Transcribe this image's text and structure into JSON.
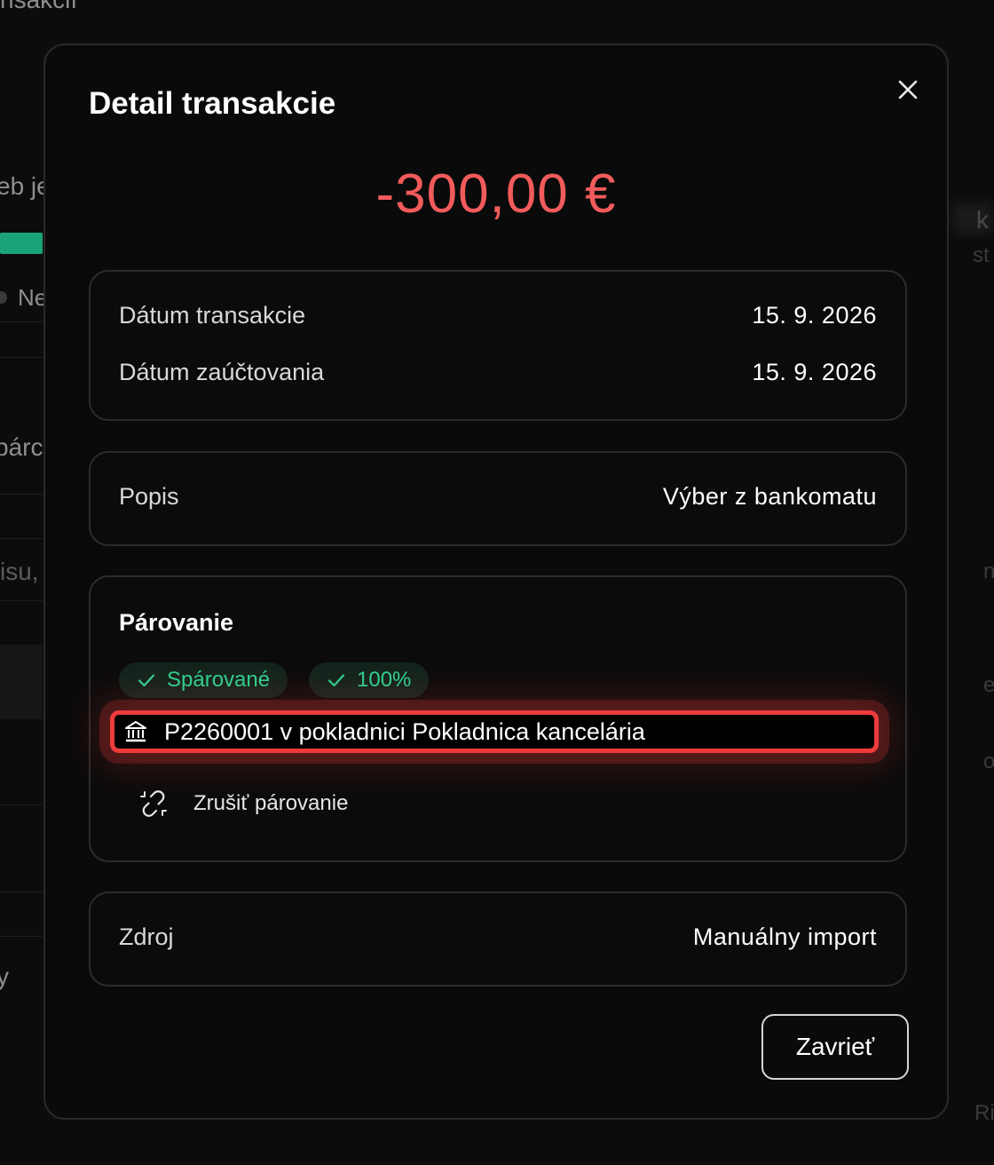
{
  "background": {
    "fragments": [
      "nsakcií",
      "eb je",
      "Ne",
      "párc",
      "isu,",
      "y",
      "k",
      "st",
      "n",
      "e",
      "o",
      "Ri"
    ],
    "accent_green": "#1aa37a"
  },
  "modal": {
    "title": "Detail transakcie",
    "close_icon": "close-icon",
    "amount": "-300,00 €",
    "amount_color": "#f25b5b"
  },
  "dates": {
    "transaction_label": "Dátum transakcie",
    "transaction_value": "15. 9. 2026",
    "posting_label": "Dátum zaúčtovania",
    "posting_value": "15. 9. 2026"
  },
  "description": {
    "label": "Popis",
    "value": "Výber z bankomatu"
  },
  "pairing": {
    "title": "Párovanie",
    "badges": [
      {
        "label": "Spárované",
        "icon": "check-icon"
      },
      {
        "label": "100%",
        "icon": "check-icon"
      }
    ],
    "badge_color": "#2dd38e",
    "linked_item": "P2260001 v pokladnici Pokladnica kancelária",
    "linked_icon": "bank-icon",
    "unpair_label": "Zrušiť párovanie",
    "unpair_icon": "unlink-icon",
    "highlight_color": "#ef3b3b"
  },
  "source": {
    "label": "Zdroj",
    "value": "Manuálny import"
  },
  "footer": {
    "close_label": "Zavrieť"
  }
}
